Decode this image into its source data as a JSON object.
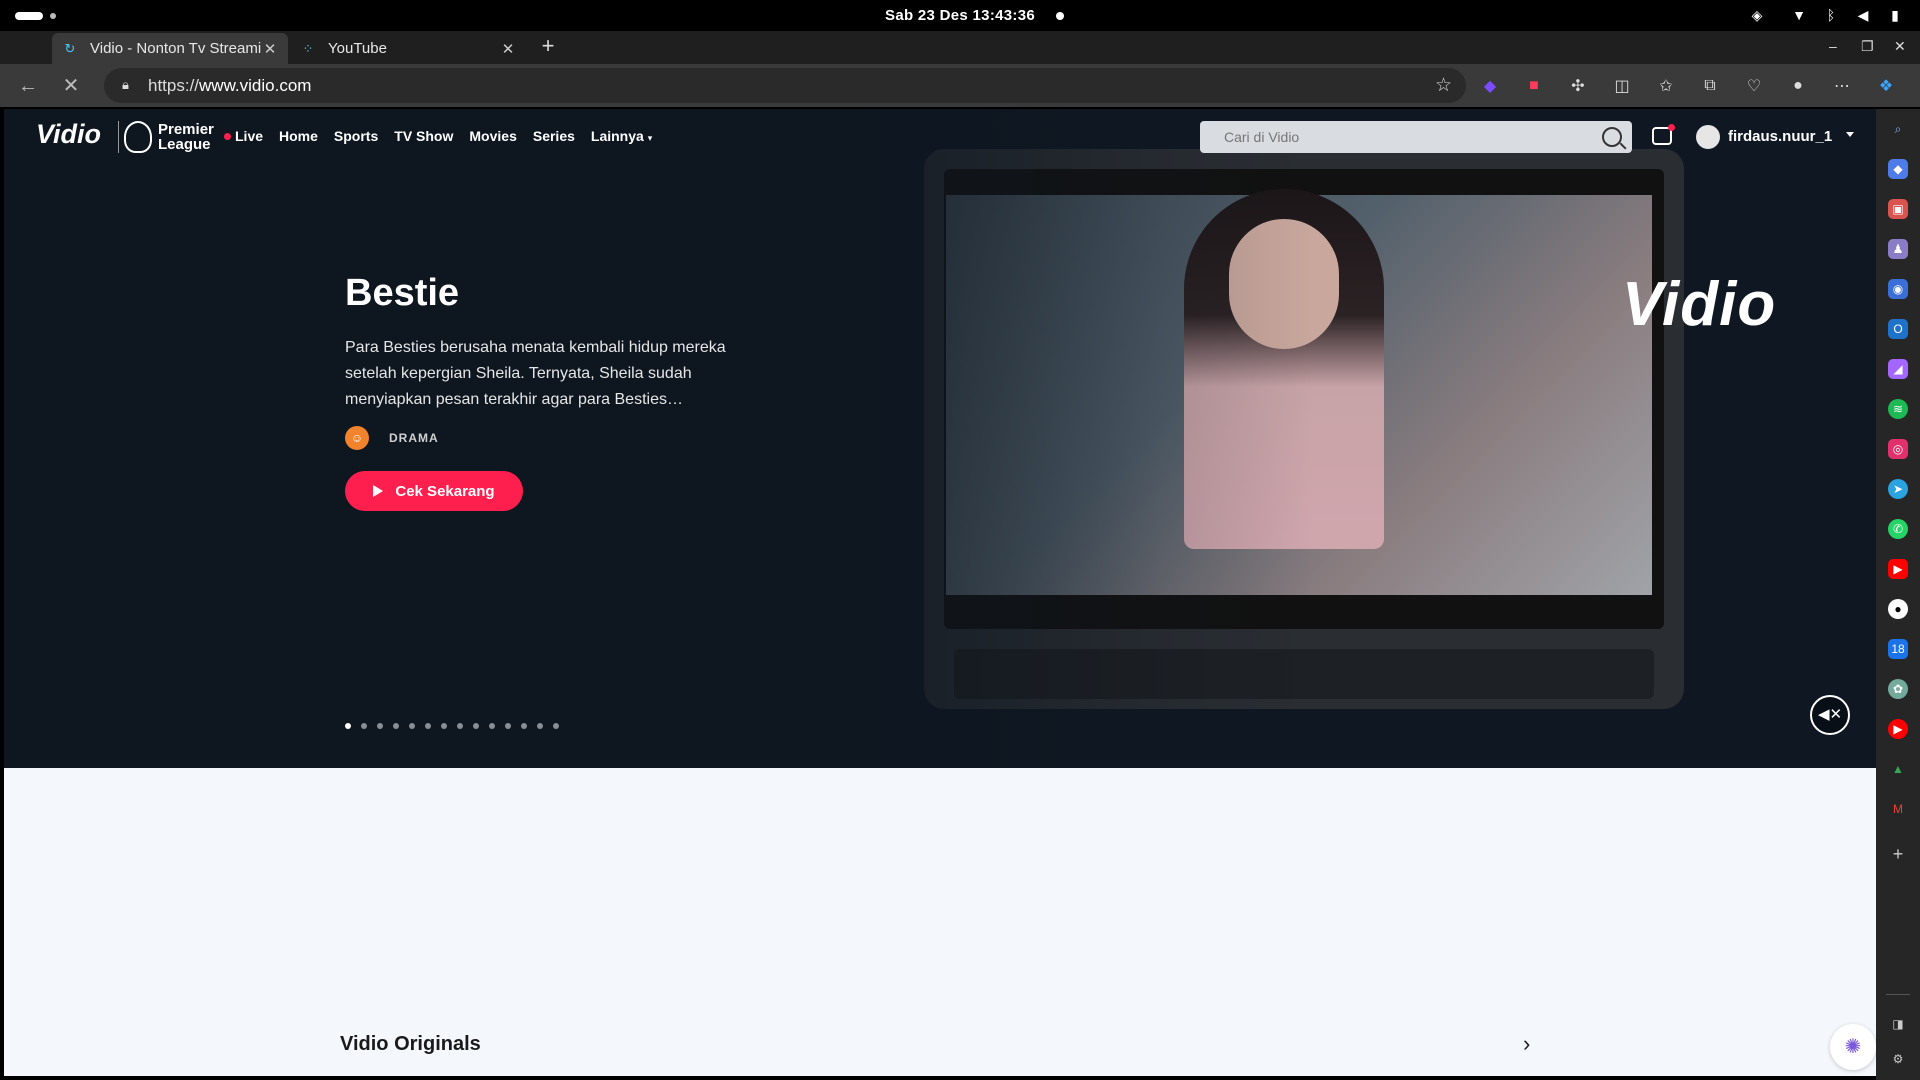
{
  "os": {
    "clock": "Sab 23 Des  13:43:36",
    "tray": [
      "shield-icon",
      "wifi-icon",
      "bluetooth-icon",
      "volume-icon",
      "battery-icon"
    ]
  },
  "browser": {
    "tabs": [
      {
        "title": "Vidio - Nonton Tv Streami",
        "active": true
      },
      {
        "title": "YouTube",
        "active": false
      }
    ],
    "url_scheme": "https://",
    "url_host": "www.vidio.com",
    "extensions": [
      "purple-ext-icon",
      "red-ext-icon",
      "puzzle-icon",
      "split-screen-icon",
      "favorites-icon",
      "collections-icon",
      "health-icon",
      "profile-icon",
      "more-icon",
      "copilot-icon"
    ],
    "window_controls": [
      "–",
      "❐",
      "✕"
    ]
  },
  "site": {
    "logo": "Vidio",
    "partner_logo": "Premier League",
    "partner_line1": "Premier",
    "partner_line2": "League",
    "nav": {
      "live": "Live",
      "home": "Home",
      "sports": "Sports",
      "tv_show": "TV Show",
      "movies": "Movies",
      "series": "Series",
      "more": "Lainnya"
    },
    "search_placeholder": "Cari di Vidio",
    "username": "firdaus.nuur_1"
  },
  "hero": {
    "title": "Bestie",
    "description": "Para Besties berusaha menata kembali hidup mereka setelah kepergian Sheila. Ternyata, Sheila sudah menyiapkan pesan terakhir agar para Besties…",
    "genre": "DRAMA",
    "cta": "Cek Sekarang",
    "watermark": "Vidio",
    "slide_count": 14,
    "active_slide": 1
  },
  "section": {
    "title": "Vidio Originals",
    "next": "›"
  },
  "colors": {
    "accent": "#ff1f4e",
    "hero_bg": "#0f1722",
    "page_bg": "#f4f7fb",
    "genre": "#f0832b"
  },
  "sidebar_icons": [
    "search-icon",
    "tag-icon",
    "toolbox-icon",
    "people-icon",
    "copilot-icon",
    "outlook-icon",
    "drop-icon",
    "spotify-icon",
    "instagram-icon",
    "telegram-icon",
    "whatsapp-icon",
    "youtube-icon",
    "github-icon",
    "calendar-icon",
    "chatgpt-icon",
    "youtube-music-icon",
    "google-drive-icon",
    "gmail-icon",
    "add-icon",
    "sidebar-toggle-icon",
    "settings-icon"
  ]
}
